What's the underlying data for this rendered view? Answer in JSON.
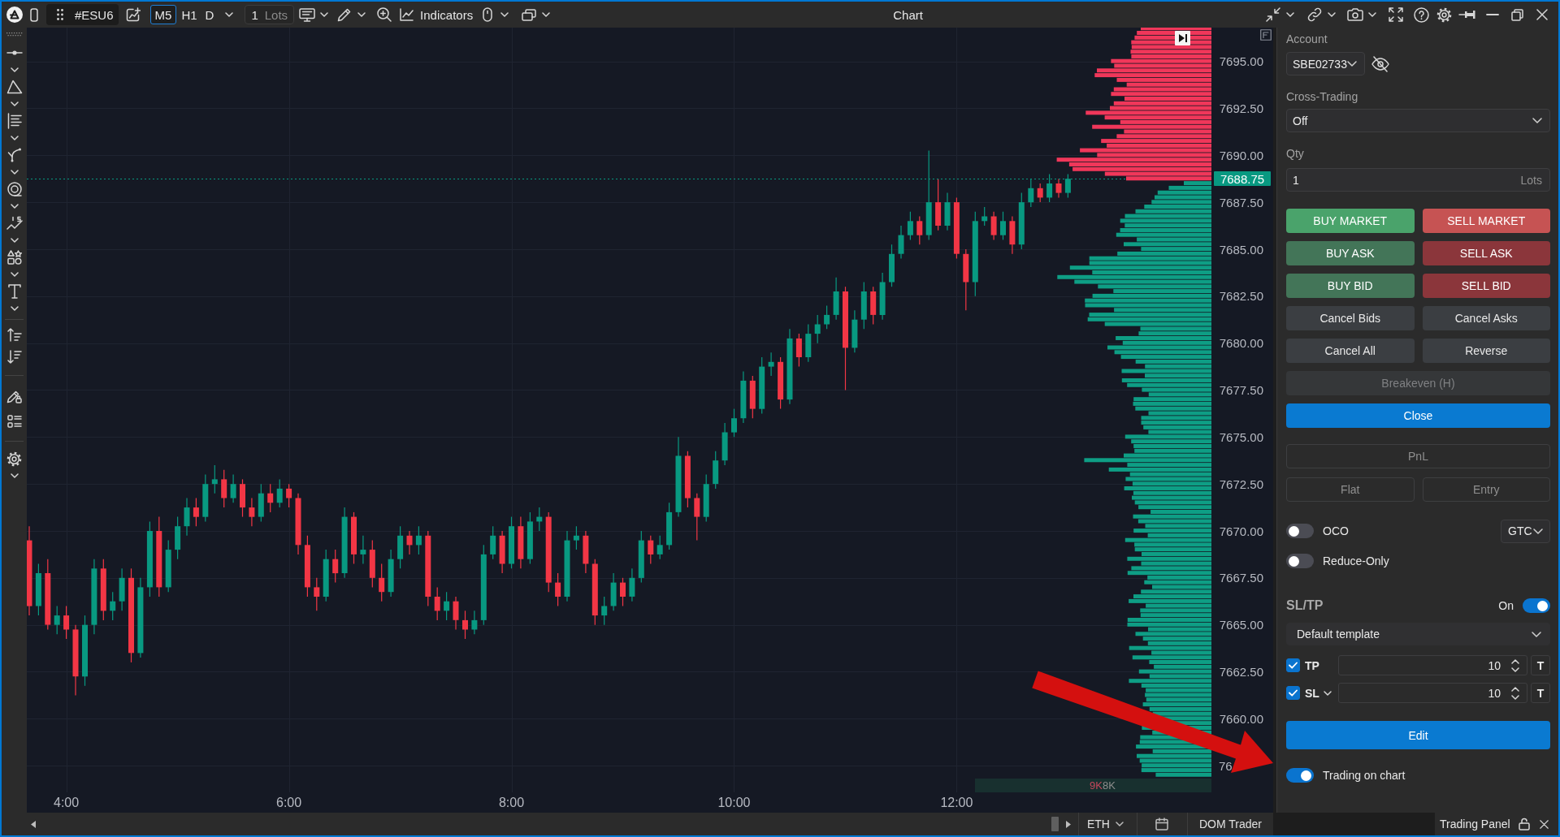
{
  "toolbar": {
    "symbol": "#ESU6",
    "timeframes": [
      {
        "label": "M5",
        "selected": true
      },
      {
        "label": "H1",
        "selected": false
      },
      {
        "label": "D",
        "selected": false
      }
    ],
    "lots": {
      "value": "1",
      "unit": "Lots"
    },
    "indicators": "Indicators"
  },
  "window": {
    "title": "Chart"
  },
  "chart": {
    "chart_data": [
      {
        "type": "candlestick",
        "x": [
          3.6667,
          3.75,
          3.8333,
          3.9167,
          4,
          4.0833,
          4.1667,
          4.25,
          4.3333,
          4.4167,
          4.5,
          4.5833,
          4.6667,
          4.75,
          4.8333,
          4.9167,
          5,
          5.0833,
          5.1667,
          5.25,
          5.3333,
          5.4167,
          5.5,
          5.5833,
          5.6667,
          5.75,
          5.8333,
          5.9167,
          6,
          6.0833,
          6.1667,
          6.25,
          6.3333,
          6.4167,
          6.5,
          6.5833,
          6.6667,
          6.75,
          6.8333,
          6.9167,
          7,
          7.0833,
          7.1667,
          7.25,
          7.3333,
          7.4167,
          7.5,
          7.5833,
          7.6667,
          7.75,
          7.8333,
          7.9167,
          8,
          8.0833,
          8.1667,
          8.25,
          8.3333,
          8.4167,
          8.5,
          8.5833,
          8.6667,
          8.75,
          8.8333,
          8.9167,
          9,
          9.0833,
          9.1667,
          9.25,
          9.3333,
          9.4167,
          9.5,
          9.5833,
          9.6667,
          9.75,
          9.8333,
          9.9167,
          10,
          10.0833,
          10.1667,
          10.25,
          10.3333,
          10.4167,
          10.5,
          10.5833,
          10.6667,
          10.75,
          10.8333,
          10.9167,
          11,
          11.0833,
          11.1667,
          11.25,
          11.3333,
          11.4167,
          11.5,
          11.5833,
          11.6667,
          11.75,
          11.8333,
          11.9167,
          12,
          12.0833,
          12.1667,
          12.25,
          12.3333,
          12.4167,
          12.5,
          12.5833,
          12.6667,
          12.75,
          12.8333,
          12.9167,
          13
        ],
        "ohlc": [
          [
            7669.5,
            7670.25,
            7665.5,
            7666
          ],
          [
            7666,
            7668.25,
            7665.5,
            7667.75
          ],
          [
            7667.75,
            7668.5,
            7664.75,
            7665
          ],
          [
            7665,
            7666,
            7664.5,
            7665.5
          ],
          [
            7665.5,
            7666,
            7664.25,
            7664.75
          ],
          [
            7664.75,
            7665,
            7661.25,
            7662.25
          ],
          [
            7662.25,
            7665.5,
            7661.75,
            7665
          ],
          [
            7665,
            7668.5,
            7664.5,
            7668
          ],
          [
            7668,
            7668.5,
            7665.25,
            7665.75
          ],
          [
            7665.75,
            7666.75,
            7665.25,
            7666.25
          ],
          [
            7666.25,
            7668,
            7665.75,
            7667.5
          ],
          [
            7667.5,
            7668,
            7663,
            7663.5
          ],
          [
            7663.5,
            7667.5,
            7663.25,
            7667
          ],
          [
            7667,
            7670.5,
            7666.5,
            7670
          ],
          [
            7670,
            7670.75,
            7666.5,
            7667
          ],
          [
            7667,
            7669.5,
            7666.75,
            7669
          ],
          [
            7669,
            7670.75,
            7668.5,
            7670.25
          ],
          [
            7670.25,
            7671.75,
            7669.75,
            7671.25
          ],
          [
            7671.25,
            7671.75,
            7670.25,
            7670.75
          ],
          [
            7670.75,
            7673,
            7670.5,
            7672.5
          ],
          [
            7672.5,
            7673.5,
            7672,
            7672.75
          ],
          [
            7672.75,
            7673.25,
            7671.25,
            7671.75
          ],
          [
            7671.75,
            7673,
            7671.5,
            7672.5
          ],
          [
            7672.5,
            7672.75,
            7670.75,
            7671.25
          ],
          [
            7671.25,
            7671.75,
            7670.25,
            7670.75
          ],
          [
            7670.75,
            7672.5,
            7670.5,
            7672
          ],
          [
            7672,
            7672.5,
            7671,
            7671.5
          ],
          [
            7671.5,
            7672.75,
            7671.25,
            7672.25
          ],
          [
            7672.25,
            7672.5,
            7671.25,
            7671.75
          ],
          [
            7671.75,
            7672,
            7668.75,
            7669.25
          ],
          [
            7669.25,
            7669.75,
            7666.5,
            7667
          ],
          [
            7667,
            7667.5,
            7665.75,
            7666.5
          ],
          [
            7666.5,
            7669,
            7666.25,
            7668.5
          ],
          [
            7668.5,
            7669,
            7667.25,
            7667.75
          ],
          [
            7667.75,
            7671.25,
            7667.5,
            7670.75
          ],
          [
            7670.75,
            7671,
            7668.25,
            7668.75
          ],
          [
            7668.75,
            7669.75,
            7668.25,
            7669
          ],
          [
            7669,
            7669.5,
            7667,
            7667.5
          ],
          [
            7667.5,
            7668.25,
            7666.25,
            7666.75
          ],
          [
            7666.75,
            7669,
            7666.5,
            7668.5
          ],
          [
            7668.5,
            7670.25,
            7668,
            7669.75
          ],
          [
            7669.75,
            7670,
            7668.75,
            7669.25
          ],
          [
            7669.25,
            7670.25,
            7668.75,
            7669.75
          ],
          [
            7669.75,
            7670,
            7666,
            7666.5
          ],
          [
            7666.5,
            7667,
            7665.25,
            7665.75
          ],
          [
            7665.75,
            7666.75,
            7665.25,
            7666.25
          ],
          [
            7666.25,
            7666.5,
            7664.75,
            7665.25
          ],
          [
            7665.25,
            7665.75,
            7664.25,
            7664.75
          ],
          [
            7664.75,
            7665.75,
            7664.5,
            7665.25
          ],
          [
            7665.25,
            7669.25,
            7665,
            7668.75
          ],
          [
            7668.75,
            7670.25,
            7668.5,
            7669.75
          ],
          [
            7669.75,
            7670,
            7667.75,
            7668.25
          ],
          [
            7668.25,
            7670.75,
            7668,
            7670.25
          ],
          [
            7670.25,
            7670.75,
            7668,
            7668.5
          ],
          [
            7668.5,
            7671,
            7668.25,
            7670.5
          ],
          [
            7670.5,
            7671.25,
            7670,
            7670.75
          ],
          [
            7670.75,
            7671,
            7666.75,
            7667.25
          ],
          [
            7667.25,
            7667.75,
            7666,
            7666.5
          ],
          [
            7666.5,
            7670,
            7666.25,
            7669.5
          ],
          [
            7669.5,
            7670.25,
            7669,
            7669.75
          ],
          [
            7669.75,
            7670,
            7667.75,
            7668.25
          ],
          [
            7668.25,
            7668.5,
            7665,
            7665.5
          ],
          [
            7665.5,
            7666.5,
            7665,
            7666
          ],
          [
            7666,
            7667.75,
            7665.75,
            7667.25
          ],
          [
            7667.25,
            7667.5,
            7666,
            7666.5
          ],
          [
            7666.5,
            7668,
            7666.25,
            7667.5
          ],
          [
            7667.5,
            7670,
            7667.25,
            7669.5
          ],
          [
            7669.5,
            7669.75,
            7668.25,
            7668.75
          ],
          [
            7668.75,
            7669.75,
            7668.5,
            7669.25
          ],
          [
            7669.25,
            7671.5,
            7669,
            7671
          ],
          [
            7671,
            7675,
            7670.75,
            7674
          ],
          [
            7674,
            7674.25,
            7671.25,
            7671.75
          ],
          [
            7671.75,
            7672,
            7669.5,
            7670.75
          ],
          [
            7670.75,
            7673,
            7670.5,
            7672.5
          ],
          [
            7672.5,
            7674.25,
            7672.25,
            7673.75
          ],
          [
            7673.75,
            7675.75,
            7673.5,
            7675.25
          ],
          [
            7675.25,
            7676.5,
            7675,
            7676
          ],
          [
            7676,
            7678.5,
            7675.75,
            7678
          ],
          [
            7678,
            7678.25,
            7676,
            7676.5
          ],
          [
            7676.5,
            7679.25,
            7676.25,
            7678.75
          ],
          [
            7678.75,
            7679.5,
            7678.25,
            7679
          ],
          [
            7679,
            7679.25,
            7676.5,
            7677
          ],
          [
            7677,
            7680.75,
            7676.75,
            7680.25
          ],
          [
            7680.25,
            7680.5,
            7678.75,
            7679.25
          ],
          [
            7679.25,
            7681,
            7679,
            7680.5
          ],
          [
            7680.5,
            7681.5,
            7680,
            7681
          ],
          [
            7681,
            7682,
            7680.75,
            7681.5
          ],
          [
            7681.5,
            7683.5,
            7681.25,
            7682.75
          ],
          [
            7682.75,
            7683,
            7677.5,
            7679.75
          ],
          [
            7679.75,
            7681.75,
            7679.5,
            7681.25
          ],
          [
            7681.25,
            7683.25,
            7680.75,
            7682.75
          ],
          [
            7682.75,
            7683,
            7681,
            7681.5
          ],
          [
            7681.5,
            7683.75,
            7681.25,
            7683.25
          ],
          [
            7683.25,
            7685.25,
            7683,
            7684.75
          ],
          [
            7684.75,
            7686.25,
            7684.5,
            7685.75
          ],
          [
            7685.75,
            7687,
            7685.5,
            7686.5
          ],
          [
            7686.5,
            7686.75,
            7685.25,
            7685.75
          ],
          [
            7685.75,
            7690.25,
            7685.5,
            7687.5
          ],
          [
            7687.5,
            7688.75,
            7686,
            7686.25
          ],
          [
            7686.25,
            7688,
            7686,
            7687.5
          ],
          [
            7687.5,
            7687.75,
            7684.5,
            7684.75
          ],
          [
            7684.75,
            7685,
            7681.75,
            7683.25
          ],
          [
            7683.25,
            7687,
            7682.5,
            7686.5
          ],
          [
            7686.5,
            7687.25,
            7686.25,
            7686.75
          ],
          [
            7686.75,
            7687,
            7685.5,
            7685.75
          ],
          [
            7685.75,
            7687,
            7685.5,
            7686.5
          ],
          [
            7686.5,
            7686.75,
            7684.75,
            7685.25
          ],
          [
            7685.25,
            7688,
            7685,
            7687.5
          ],
          [
            7687.5,
            7688.75,
            7687.25,
            7688.25
          ],
          [
            7688.25,
            7688.5,
            7687.5,
            7687.75
          ],
          [
            7687.75,
            7689,
            7687.5,
            7688.5
          ],
          [
            7688.5,
            7688.75,
            7687.75,
            7688
          ],
          [
            7688,
            7689,
            7687.75,
            7688.75
          ]
        ],
        "xlim": [
          3.645,
          14.844
        ],
        "xticks": [
          {
            "value": 4,
            "label": "4:00"
          },
          {
            "value": 6,
            "label": "6:00"
          },
          {
            "value": 8,
            "label": "8:00"
          },
          {
            "value": 10,
            "label": "10:00"
          },
          {
            "value": 12,
            "label": "12:00"
          }
        ],
        "ylim": [
          7655.0,
          7696.8
        ],
        "yticks": [
          {
            "value": 7695,
            "label": "7695.00"
          },
          {
            "value": 7692.5,
            "label": "7692.50"
          },
          {
            "value": 7690,
            "label": "7690.00"
          },
          {
            "value": 7687.5,
            "label": "7687.50"
          },
          {
            "value": 7685,
            "label": "7685.00"
          },
          {
            "value": 7682.5,
            "label": "7682.50"
          },
          {
            "value": 7680,
            "label": "7680.00"
          },
          {
            "value": 7677.5,
            "label": "7677.50"
          },
          {
            "value": 7675,
            "label": "7675.00"
          },
          {
            "value": 7672.5,
            "label": "7672.50"
          },
          {
            "value": 7670,
            "label": "7670.00"
          },
          {
            "value": 7667.5,
            "label": "7667.50"
          },
          {
            "value": 7665,
            "label": "7665.00"
          },
          {
            "value": 7662.5,
            "label": "7662.50"
          },
          {
            "value": 7660,
            "label": "7660.00"
          }
        ],
        "grid": true,
        "ref_lines": [
          {
            "axis": "y",
            "value": 7688.75,
            "label": "7688.75",
            "color": "#089981",
            "line_style": "dotted"
          }
        ]
      }
    ],
    "cut_axis_label": "76",
    "volume_profile": {
      "labels": [
        {
          "text": "9K",
          "color": "#c4475b"
        },
        {
          "text": "8K",
          "color": "#8c8c8c"
        }
      ]
    }
  },
  "trading_panel": {
    "account": {
      "label": "Account",
      "value": "SBE02733"
    },
    "cross_trading": {
      "label": "Cross-Trading",
      "value": "Off"
    },
    "qty": {
      "label": "Qty",
      "value": "1",
      "unit": "Lots"
    },
    "order_buttons": [
      {
        "label": "BUY MARKET",
        "kind": "buy",
        "highlighted": true
      },
      {
        "label": "SELL MARKET",
        "kind": "sell",
        "highlighted": true
      },
      {
        "label": "BUY ASK",
        "kind": "buy",
        "highlighted": false
      },
      {
        "label": "SELL ASK",
        "kind": "sell",
        "highlighted": false
      },
      {
        "label": "BUY BID",
        "kind": "buy",
        "highlighted": false
      },
      {
        "label": "SELL BID",
        "kind": "sell",
        "highlighted": false
      },
      {
        "label": "Cancel Bids",
        "kind": "neutral",
        "highlighted": false
      },
      {
        "label": "Cancel Asks",
        "kind": "neutral",
        "highlighted": false
      },
      {
        "label": "Cancel All",
        "kind": "neutral",
        "highlighted": false
      },
      {
        "label": "Reverse",
        "kind": "neutral",
        "highlighted": false
      }
    ],
    "breakeven_button": {
      "label": "Breakeven (H)",
      "disabled": true
    },
    "close_button": {
      "label": "Close"
    },
    "pnl": {
      "label": "PnL"
    },
    "position_buttons": [
      {
        "label": "Flat"
      },
      {
        "label": "Entry"
      }
    ],
    "toggles": [
      {
        "label": "OCO",
        "on": false
      },
      {
        "label": "Reduce-Only",
        "on": false
      }
    ],
    "time_in_force": {
      "value": "GTC"
    },
    "sl_tp": {
      "title": "SL/TP",
      "toggle_label": "On",
      "on": true,
      "template": "Default template",
      "rows": [
        {
          "label": "TP",
          "checked": true,
          "dropdown": false,
          "value": "10",
          "unit": "T"
        },
        {
          "label": "SL",
          "checked": true,
          "dropdown": true,
          "value": "10",
          "unit": "T"
        }
      ]
    },
    "edit_button": {
      "label": "Edit"
    },
    "trading_on_chart": {
      "label": "Trading on chart",
      "on": true
    },
    "tab_title": "Trading Panel"
  },
  "bottom_bar": {
    "session": "ETH",
    "dom_trader": "DOM Trader"
  }
}
